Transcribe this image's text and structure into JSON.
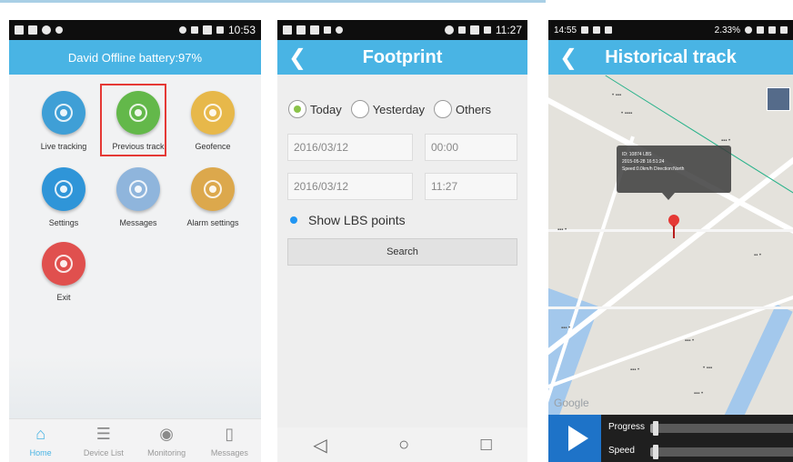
{
  "phone1": {
    "status_time": "10:53",
    "header": "David Offline battery:97%",
    "grid": [
      {
        "label": "Live tracking",
        "color": "#3f9fd6",
        "icon": "crosshair-icon"
      },
      {
        "label": "Previous track",
        "color": "#63b84a",
        "icon": "person-pin-icon",
        "highlighted": true
      },
      {
        "label": "Geofence",
        "color": "#e7b84a",
        "icon": "geofence-icon"
      },
      {
        "label": "Settings",
        "color": "#2f95d8",
        "icon": "gear-icon"
      },
      {
        "label": "Messages",
        "color": "#8fb5dc",
        "icon": "envelope-icon"
      },
      {
        "label": "Alarm settings",
        "color": "#dca84c",
        "icon": "bell-icon"
      },
      {
        "label": "Exit",
        "color": "#e0504e",
        "icon": "exit-icon"
      }
    ],
    "nav": [
      {
        "label": "Home",
        "icon": "home-icon",
        "glyph": "⌂",
        "active": true
      },
      {
        "label": "Device List",
        "icon": "list-icon",
        "glyph": "☰",
        "active": false
      },
      {
        "label": "Monitoring",
        "icon": "eye-icon",
        "glyph": "◉",
        "active": false
      },
      {
        "label": "Messages",
        "icon": "map-icon",
        "glyph": "▯",
        "active": false
      }
    ]
  },
  "phone2": {
    "status_time": "11:27",
    "title": "Footprint",
    "radios": [
      {
        "label": "Today",
        "selected": true
      },
      {
        "label": "Yesterday",
        "selected": false
      },
      {
        "label": "Others",
        "selected": false
      }
    ],
    "start_date": "2016/03/12",
    "start_time": "00:00",
    "end_date": "2016/03/12",
    "end_time": "11:27",
    "lbs_label": "Show LBS points",
    "search_label": "Search",
    "sysnav": [
      "◁",
      "○",
      "□"
    ]
  },
  "phone3": {
    "status_time": "14:55",
    "status_right": "2.33%",
    "title": "Historical track",
    "popup_lines": [
      "ID: 10874 LBS",
      "2015-05-28 16:51:24",
      "Speed:0.0km/h  Direction:North"
    ],
    "google": "Google",
    "progress_label": "Progress",
    "speed_label": "Speed",
    "progress": 0.04,
    "speed": 0.04
  },
  "colors": {
    "accent": "#49b4e4",
    "highlight": "#e53935",
    "play": "#1e73c8"
  }
}
